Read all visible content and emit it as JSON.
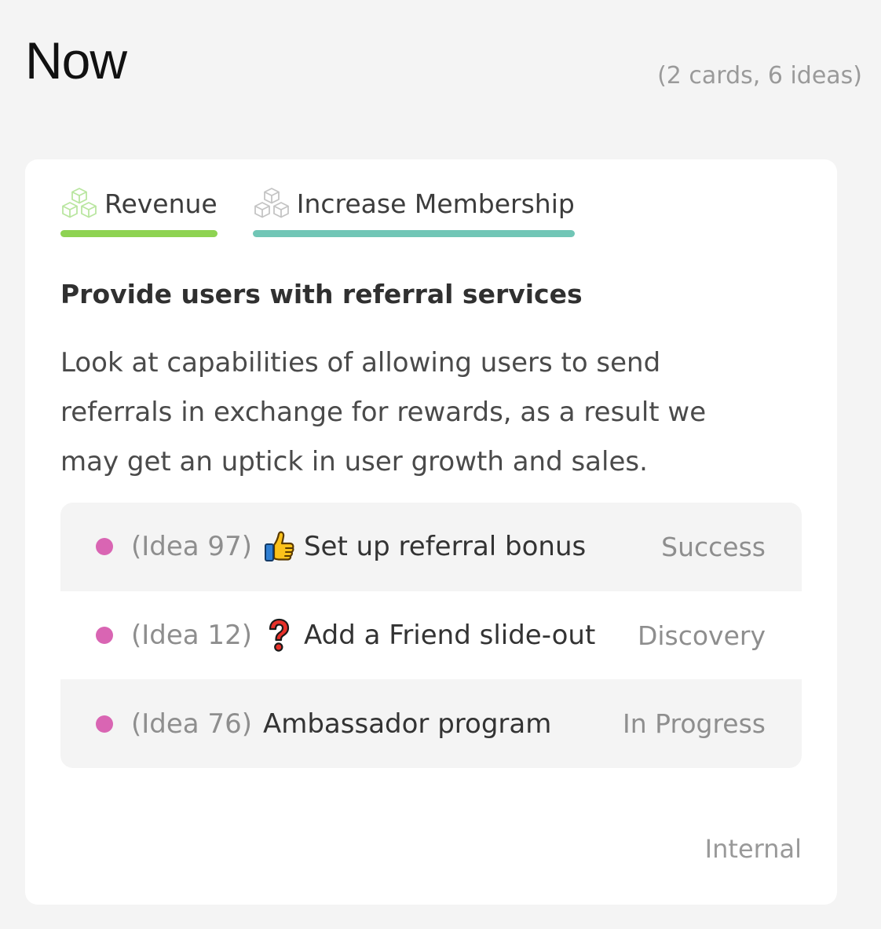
{
  "column": {
    "title": "Now",
    "count_text": "(2 cards, 6 ideas)"
  },
  "card": {
    "tags": [
      {
        "label": "Revenue",
        "icon": "cubes-icon",
        "bar_color": "#8ed352",
        "icon_color": "#b9e6a0"
      },
      {
        "label": "Increase Membership",
        "icon": "cubes-icon",
        "bar_color": "#71c6b6",
        "icon_color": "#c4c4c4"
      }
    ],
    "title": "Provide users with referral services",
    "description": "Look at capabilities of allowing users to send referrals in exchange for rewards, as a result we may get an uptick in user growth and sales.",
    "ideas": [
      {
        "ref": "(Idea 97)",
        "emoji": "thumbs-up-icon",
        "name": "Set up referral bonus",
        "status": "Success",
        "dot_color": "#d965b3"
      },
      {
        "ref": "(Idea 12)",
        "emoji": "question-mark-icon",
        "name": "Add a Friend slide-out",
        "status": "Discovery",
        "dot_color": "#d965b3"
      },
      {
        "ref": "(Idea 76)",
        "emoji": "",
        "name": "Ambassador program",
        "status": "In Progress",
        "dot_color": "#d965b3"
      }
    ],
    "footer": "Internal"
  }
}
